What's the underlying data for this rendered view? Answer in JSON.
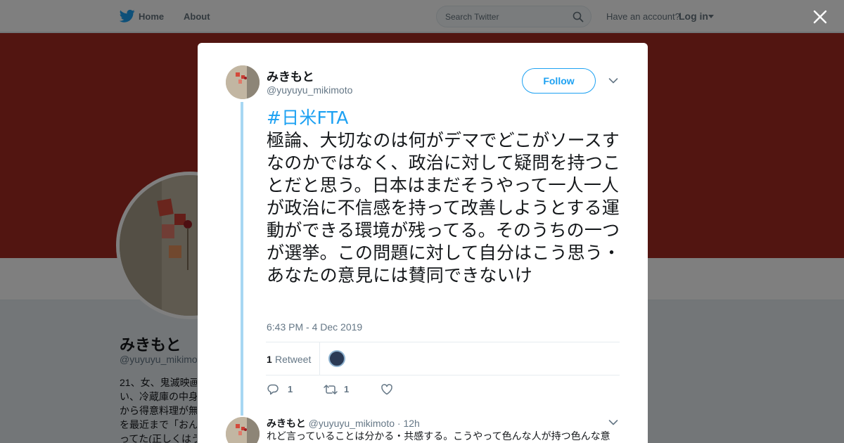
{
  "nav": {
    "home_label": "Home",
    "about_label": "About",
    "search_placeholder": "Search Twitter",
    "have_account_text": "Have an account?",
    "login_label": "Log in"
  },
  "profile": {
    "name": "みきもと",
    "handle": "@yuyuyu_mikimoto",
    "bio": "21、女、鬼滅映画\nい、冷蔵庫の中身\nから得意料理が無\nを最近まで「おん\nってた(正しくはう"
  },
  "tweet": {
    "author_name": "みきもと",
    "author_handle": "@yuyuyu_mikimoto",
    "follow_label": "Follow",
    "hashtag": "#日米FTA",
    "body": "極論、大切なのは何がデマでどこがソースすなのかではなく、政治に対して疑問を持つことだと思う。日本はまだそうやって一人一人が政治に不信感を持って改善しようとする運動ができる環境が残ってる。そのうちの一つが選挙。この問題に対して自分はこう思う・あなたの意見には賛同できないけ",
    "timestamp": "6:43 PM - 4 Dec 2019",
    "retweet_count": "1",
    "retweet_label": "Retweet",
    "reply_count": "1",
    "retweet_action_count": "1",
    "like_count": ""
  },
  "reply": {
    "name": "みきもと",
    "handle": "@yuyuyu_mikimoto",
    "separator": "·",
    "time": "12h",
    "text": "れど言っていることは分かる・共感する。こうやって色んな人が持つ色んな意"
  },
  "colors": {
    "accent": "#1da1f2",
    "banner": "#a52a22",
    "thread_line": "#a7d7f3",
    "overlay": "rgba(0,0,0,0.5)"
  },
  "icons": {
    "logo": "twitter-bird-icon",
    "search": "search-icon",
    "close": "close-icon",
    "chevron": "chevron-down-icon",
    "reply": "reply-icon",
    "retweet": "retweet-icon",
    "like": "heart-icon"
  }
}
